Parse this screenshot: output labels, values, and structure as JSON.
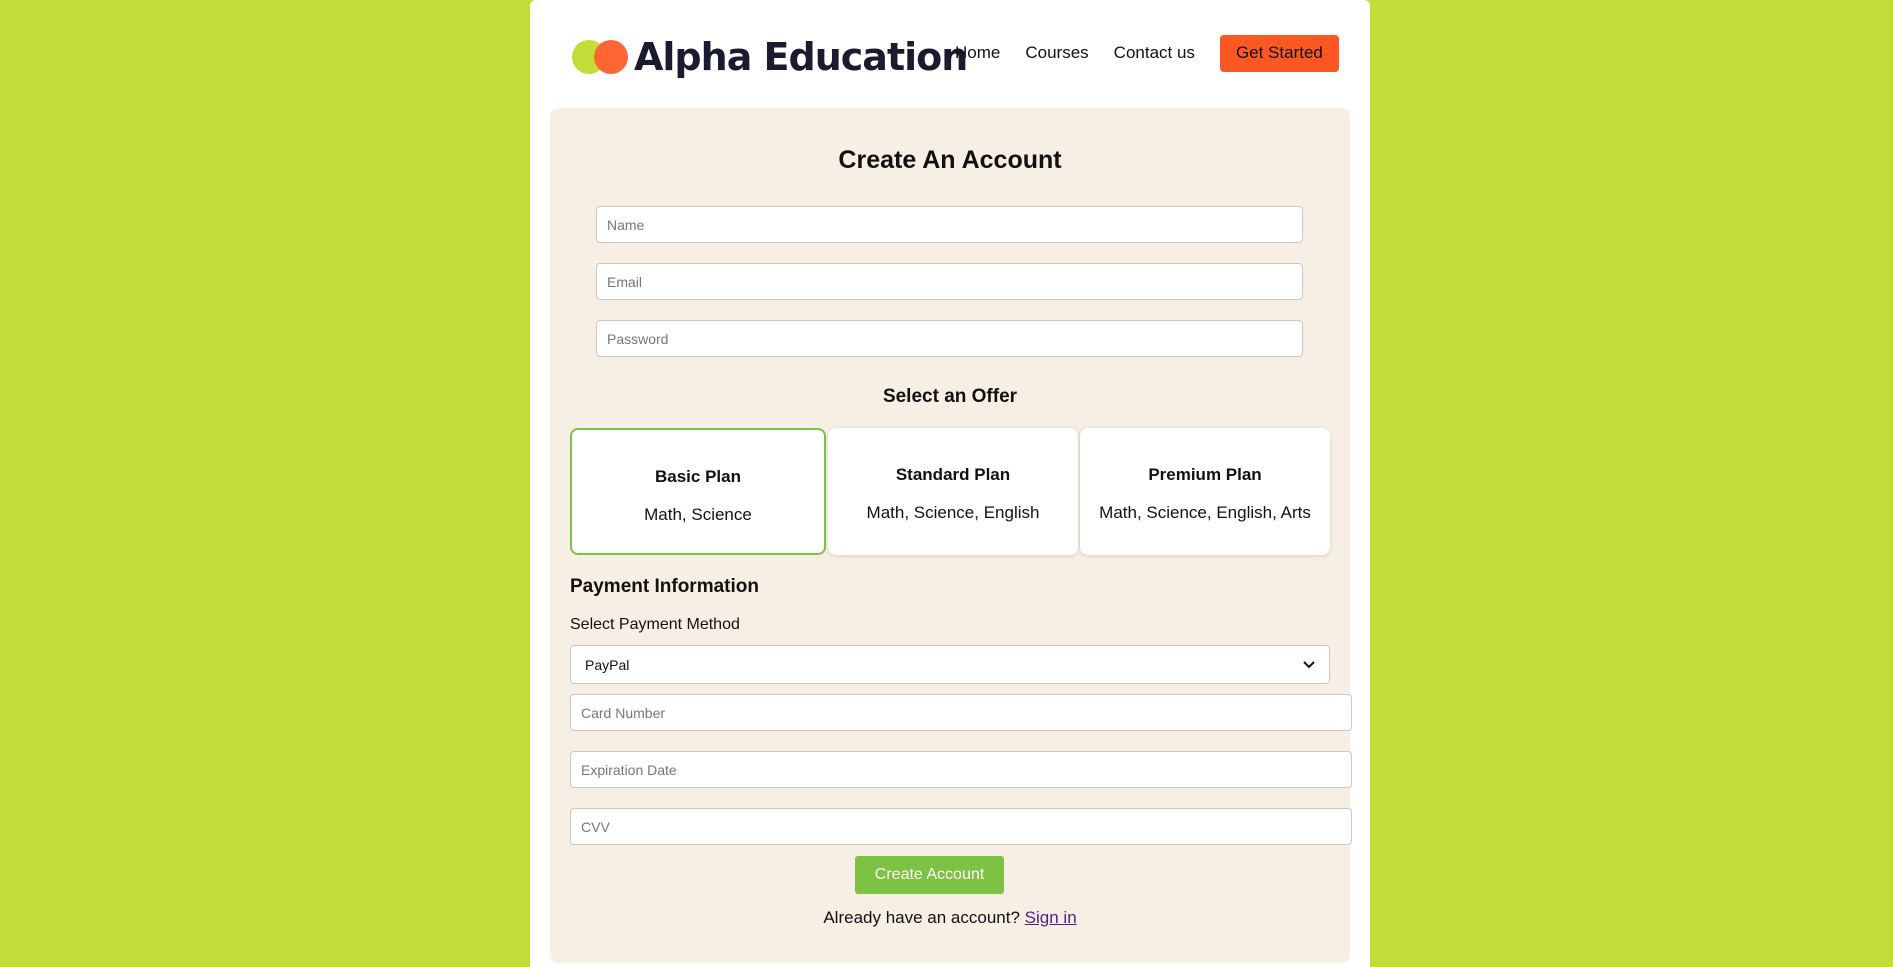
{
  "header": {
    "brand": "Alpha Education",
    "nav": [
      "Home",
      "Courses",
      "Contact us"
    ],
    "cta_label": "Get Started"
  },
  "colors": {
    "background": "#c3dc37",
    "accent_orange": "#ff5722",
    "accent_green": "#7dc242",
    "panel": "#f7efe4"
  },
  "form": {
    "title": "Create An Account",
    "name_placeholder": "Name",
    "email_placeholder": "Email",
    "password_placeholder": "Password",
    "offer_title": "Select an Offer",
    "plans": [
      {
        "name": "Basic Plan",
        "subjects": "Math, Science",
        "selected": true
      },
      {
        "name": "Standard Plan",
        "subjects": "Math, Science, English",
        "selected": false
      },
      {
        "name": "Premium Plan",
        "subjects": "Math, Science, English, Arts",
        "selected": false
      }
    ],
    "payment_title": "Payment Information",
    "payment_method_label": "Select Payment Method",
    "payment_method_value": "PayPal",
    "card_placeholder": "Card Number",
    "expiry_placeholder": "Expiration Date",
    "cvv_placeholder": "CVV",
    "submit_label": "Create Account",
    "signin_prompt": "Already have an account?",
    "signin_link": "Sign in"
  }
}
